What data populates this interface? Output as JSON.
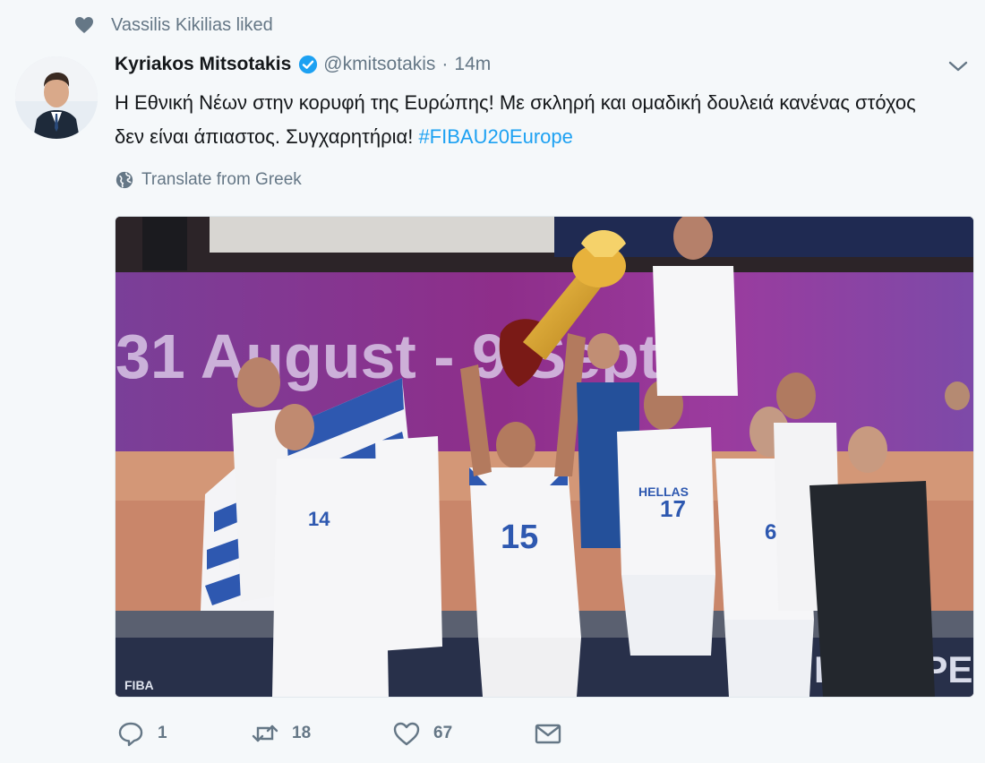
{
  "social_context": {
    "icon": "heart-icon",
    "text": "Vassilis Kikilias liked"
  },
  "tweet": {
    "fullname": "Kyriakos Mitsotakis",
    "screen_name": "@kmitsotakis",
    "separator": "·",
    "time": "14m",
    "text_main": "Η Εθνική Νέων στην κορυφή της Ευρώπης! Με σκληρή και ομαδική δουλειά κανένας στόχος δεν είναι άπιαστος. Συγχαρητήρια! ",
    "hashtag": "#FIBAU20Europe",
    "translate_label": "Translate from Greek"
  },
  "media": {
    "board_text": "31 August - 9 Sept",
    "jersey_15": "15",
    "jersey_17": "17",
    "jersey_6": "6",
    "jersey_14": "14",
    "jersey_hellas": "HELLAS",
    "corner_label": "FIBA",
    "floor_text": "EUROPE"
  },
  "actions": {
    "reply_count": "1",
    "retweet_count": "18",
    "like_count": "67"
  },
  "colors": {
    "accent": "#1da1f2",
    "muted": "#657786",
    "background": "#f5f8fa"
  }
}
